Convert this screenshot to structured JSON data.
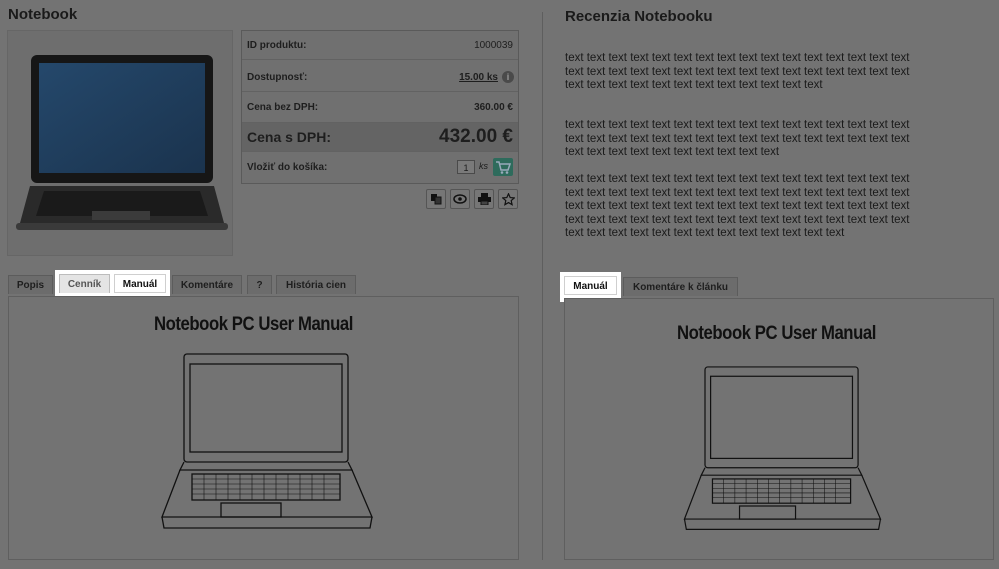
{
  "product": {
    "title": "Notebook",
    "photo_alt": "laptop-photo",
    "rows": {
      "id_label": "ID produktu:",
      "id_value": "1000039",
      "availability_label": "Dostupnosť:",
      "availability_value": "15.00 ks",
      "price_no_vat_label": "Cena bez DPH:",
      "price_no_vat_value": "360.00 €",
      "price_vat_label": "Cena s DPH:",
      "price_vat_value": "432.00 €",
      "add_to_cart_label": "Vložiť do košíka:",
      "qty_value": "1",
      "qty_unit": "ks"
    },
    "action_icons": [
      "compare-icon",
      "eye-icon",
      "print-icon",
      "star-icon"
    ],
    "tabs": [
      "Popis",
      "Cenník",
      "Manuál",
      "Komentáre",
      "?",
      "História cien"
    ],
    "active_tab": "Manuál",
    "manual_title": "Notebook PC User Manual"
  },
  "review": {
    "title": "Recenzia Notebooku",
    "paragraphs": [
      "text text text text text text text text text text text text text text text text text text text text text text text text text text text text text text text text text text text text text text text text text text text text",
      "text text text text text text text text text text text text text text text text text text text text text text text text text text text text text text text text text text text text text text text text text text",
      "text text text text text text text text text text text text text text text text text text text text text text text text text text text text text text text text text text text text text text text text text text text text text text text text text text text text text text text text text text text text text text text text text text text text text text text text text text text text text"
    ],
    "tabs": [
      "Manuál",
      "Komentáre k článku"
    ],
    "active_tab": "Manuál",
    "manual_title": "Notebook PC User Manual"
  },
  "colors": {
    "overlay": "#737373",
    "cart": "#2e6b5c",
    "highlight": "#ffffff"
  }
}
